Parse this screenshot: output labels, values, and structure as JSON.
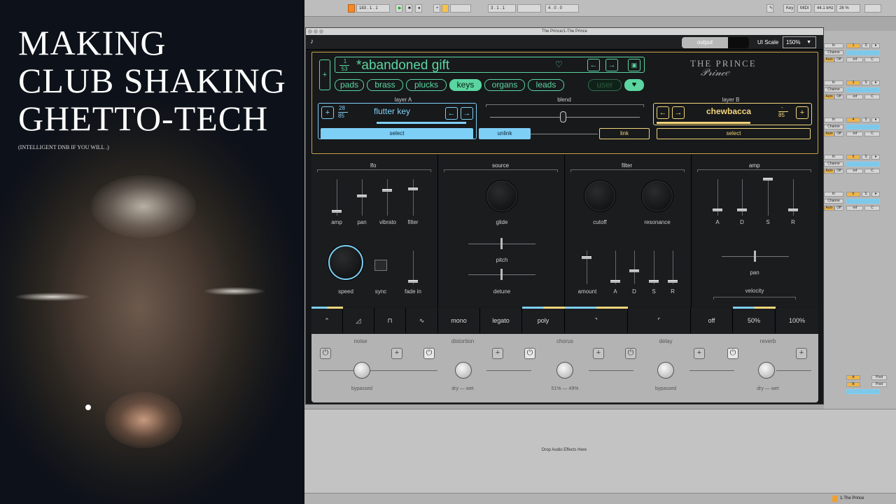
{
  "overlay": {
    "title_lines": [
      "MAKING",
      "CLUB SHAKING",
      "GHETTO-TECH"
    ],
    "subtitle": "(INTELLIGENT DNB IF YOU WILL .)"
  },
  "daw": {
    "transport": {
      "tempo": "183 . 1 . 1",
      "position": "3 . 1 . 1",
      "bars": "4 . 0 . 0",
      "key_label": "Key",
      "midi_label": "MIDI",
      "sample_rate": "44.1 kHz",
      "cpu": "26 %"
    },
    "mixer": {
      "ch_label": "In",
      "chan_label": "Channe",
      "auto": "Auto",
      "off": "Off",
      "inf": "-inf",
      "c": "C",
      "tracks": [
        "1",
        "3",
        "4",
        "5",
        "6"
      ],
      "sends": [
        "A",
        "B"
      ],
      "post": "Post",
      "db": "-6.0"
    },
    "drop_text": "Drop Audio Effects Here",
    "bottom_track": "1-The Prince"
  },
  "plugin": {
    "window_title": "The Prince/1-The Prince",
    "output_label": "output",
    "ui_scale_label": "UI Scale",
    "ui_scale_value": "150%",
    "brand": "THE PRINCE",
    "preset": {
      "index": "1",
      "total": "53",
      "name": "*abandoned gift"
    },
    "categories": [
      "pads",
      "brass",
      "plucks",
      "keys",
      "organs",
      "leads",
      "user"
    ],
    "selected_category": "keys",
    "layer_a": {
      "title": "layer A",
      "index": "28",
      "total": "85",
      "name": "flutter key",
      "select": "select",
      "unlink": "unlink"
    },
    "blend_label": "blend",
    "layer_b": {
      "title": "layer B",
      "index": "-",
      "total": "85",
      "name": "chewbacca",
      "link": "link",
      "select": "select"
    },
    "sections": {
      "lfo": {
        "title": "lfo",
        "sliders": [
          "amp",
          "pan",
          "vibrato",
          "filter"
        ],
        "speed": "speed",
        "sync": "sync",
        "fade_in": "fade in"
      },
      "source": {
        "title": "source",
        "glide": "glide",
        "pitch": "pitch",
        "detune": "detune"
      },
      "filter": {
        "title": "filter",
        "cutoff": "cutoff",
        "resonance": "resonance",
        "amount": "amount",
        "env": [
          "A",
          "D",
          "S",
          "R"
        ]
      },
      "amp": {
        "title": "amp",
        "env": [
          "A",
          "D",
          "S",
          "R"
        ],
        "pan": "pan",
        "velocity": "velocity"
      }
    },
    "modes": {
      "voice": [
        "mono",
        "legato",
        "poly"
      ],
      "velocity": [
        "off",
        "50%",
        "100%"
      ]
    },
    "fx": [
      {
        "name": "noise",
        "status": "bypassed"
      },
      {
        "name": "distortion",
        "status": "dry — wet"
      },
      {
        "name": "chorus",
        "status": "51% — 49%"
      },
      {
        "name": "delay",
        "status": "bypassed"
      },
      {
        "name": "reverb",
        "status": "dry — wet"
      }
    ],
    "colors": {
      "green": "#5bd6a0",
      "blue": "#7dcff6",
      "yellow": "#f3d57a",
      "gold": "#caa24a"
    }
  }
}
